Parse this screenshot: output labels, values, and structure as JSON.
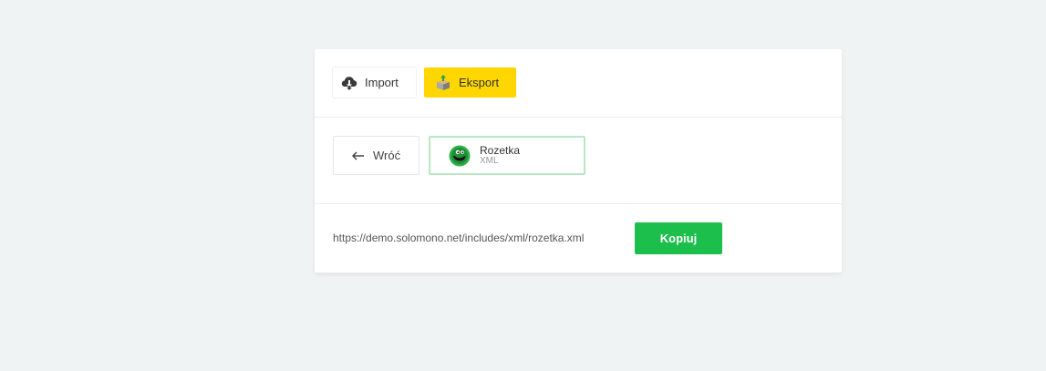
{
  "tabs": {
    "import": {
      "label": "Import",
      "icon": "cloud-download-icon"
    },
    "export": {
      "label": "Eksport",
      "icon": "box-upload-icon",
      "active_color": "#ffd600"
    }
  },
  "nav": {
    "back_label": "Wróć",
    "back_icon": "arrow-left-icon"
  },
  "channel": {
    "name": "Rozetka",
    "format": "XML",
    "logo_icon": "rozetka-logo-icon",
    "border_color": "#b8e7c5"
  },
  "export_link": {
    "url": "https://demo.solomono.net/includes/xml/rozetka.xml",
    "copy_label": "Kopiuj",
    "button_color": "#1cbf4c"
  }
}
